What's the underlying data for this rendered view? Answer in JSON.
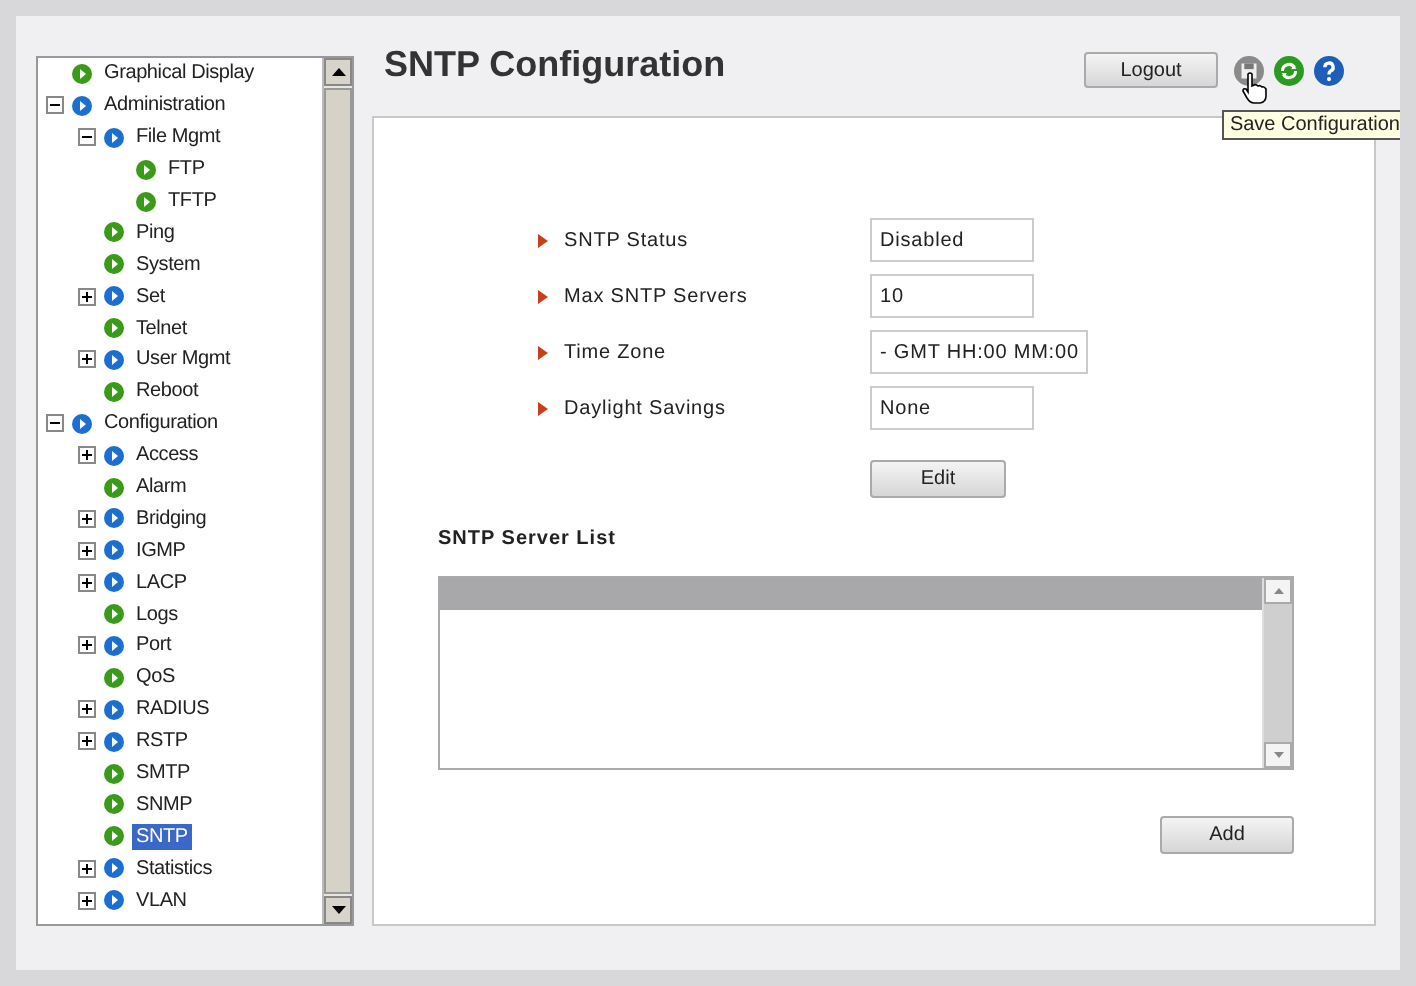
{
  "tree": [
    {
      "label": "Graphical Display",
      "kind": "page",
      "selected": false
    },
    {
      "label": "Administration",
      "kind": "folder",
      "expanded": true,
      "selected": false,
      "children": [
        {
          "label": "File Mgmt",
          "kind": "folder",
          "expanded": true,
          "selected": false,
          "children": [
            {
              "label": "FTP",
              "kind": "page",
              "selected": false
            },
            {
              "label": "TFTP",
              "kind": "page",
              "selected": false
            }
          ]
        },
        {
          "label": "Ping",
          "kind": "page",
          "selected": false
        },
        {
          "label": "System",
          "kind": "page",
          "selected": false
        },
        {
          "label": "Set",
          "kind": "folder",
          "expanded": false,
          "selected": false
        },
        {
          "label": "Telnet",
          "kind": "page",
          "selected": false
        },
        {
          "label": "User Mgmt",
          "kind": "folder",
          "expanded": false,
          "selected": false
        },
        {
          "label": "Reboot",
          "kind": "page",
          "selected": false
        }
      ]
    },
    {
      "label": "Configuration",
      "kind": "folder",
      "expanded": true,
      "selected": false,
      "children": [
        {
          "label": "Access",
          "kind": "folder",
          "expanded": false,
          "selected": false
        },
        {
          "label": "Alarm",
          "kind": "page",
          "selected": false
        },
        {
          "label": "Bridging",
          "kind": "folder",
          "expanded": false,
          "selected": false
        },
        {
          "label": "IGMP",
          "kind": "folder",
          "expanded": false,
          "selected": false
        },
        {
          "label": "LACP",
          "kind": "folder",
          "expanded": false,
          "selected": false
        },
        {
          "label": "Logs",
          "kind": "page",
          "selected": false
        },
        {
          "label": "Port",
          "kind": "folder",
          "expanded": false,
          "selected": false
        },
        {
          "label": "QoS",
          "kind": "page",
          "selected": false
        },
        {
          "label": "RADIUS",
          "kind": "folder",
          "expanded": false,
          "selected": false
        },
        {
          "label": "RSTP",
          "kind": "folder",
          "expanded": false,
          "selected": false
        },
        {
          "label": "SMTP",
          "kind": "page",
          "selected": false
        },
        {
          "label": "SNMP",
          "kind": "page",
          "selected": false
        },
        {
          "label": "SNTP",
          "kind": "page",
          "selected": true
        },
        {
          "label": "Statistics",
          "kind": "folder",
          "expanded": false,
          "selected": false
        },
        {
          "label": "VLAN",
          "kind": "folder",
          "expanded": false,
          "selected": false
        }
      ]
    }
  ],
  "header": {
    "title": "SNTP Configuration",
    "logout": "Logout",
    "tooltip": "Save Configuration"
  },
  "fields": [
    {
      "label": "SNTP Status",
      "value": "Disabled"
    },
    {
      "label": "Max SNTP Servers",
      "value": "10"
    },
    {
      "label": "Time Zone",
      "value": "- GMT HH:00 MM:00"
    },
    {
      "label": "Daylight Savings",
      "value": "None"
    }
  ],
  "edit_button": "Edit",
  "server_list": {
    "title": "SNTP Server List",
    "add_button": "Add"
  }
}
